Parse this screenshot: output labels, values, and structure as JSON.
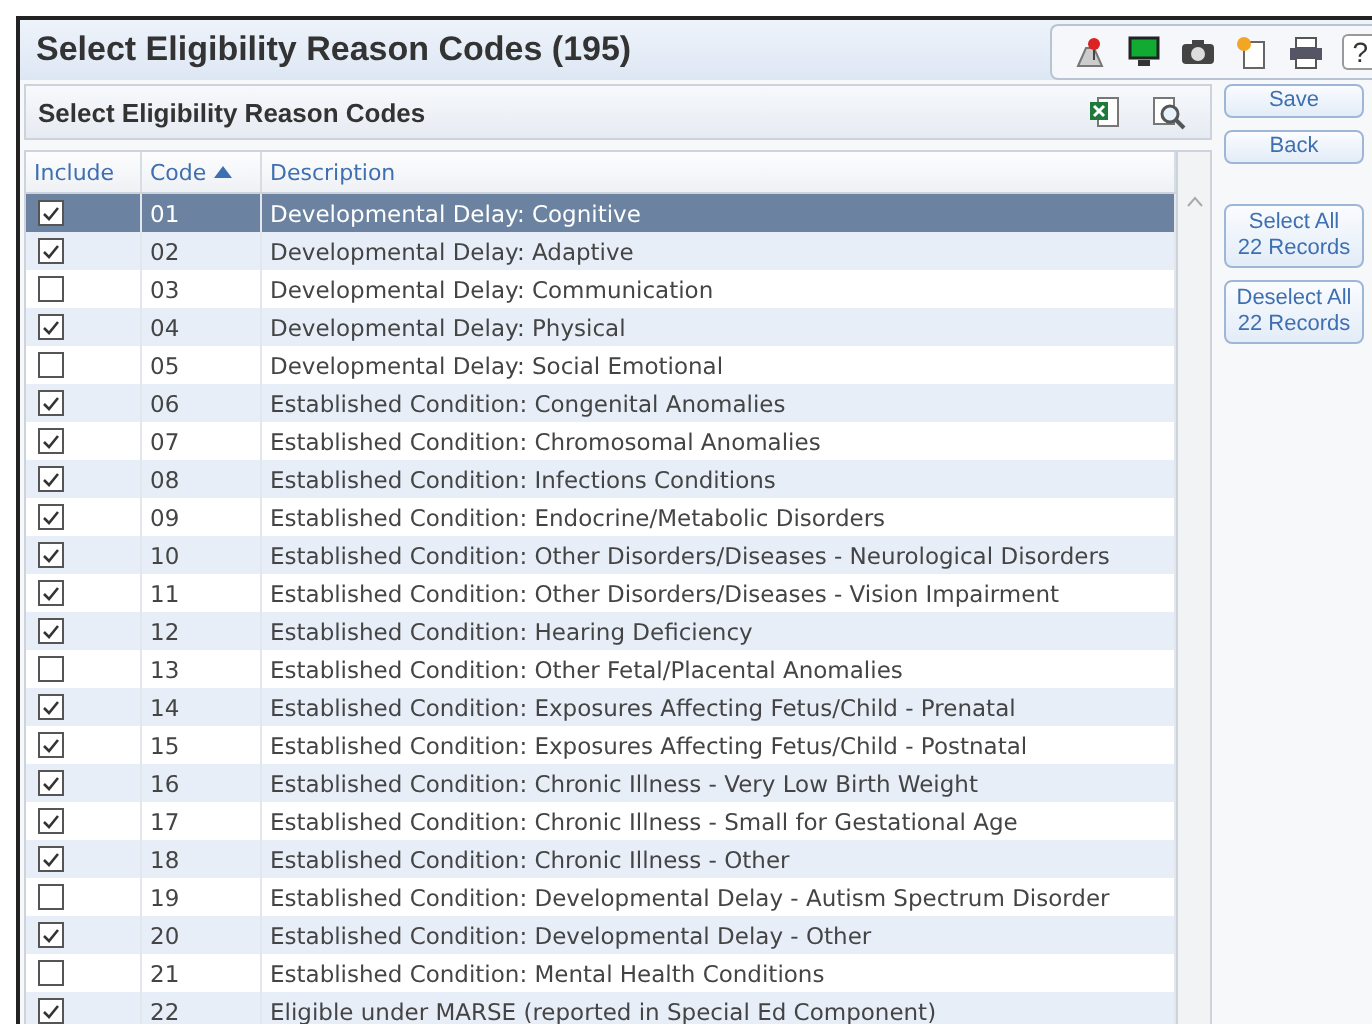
{
  "page": {
    "title": "Select Eligibility Reason Codes (195)",
    "help": "?"
  },
  "panel": {
    "title": "Select Eligibility Reason Codes"
  },
  "table": {
    "columns": [
      {
        "label": "Include",
        "sorted": false
      },
      {
        "label": "Code",
        "sorted": true
      },
      {
        "label": "Description",
        "sorted": false
      }
    ],
    "rows": [
      {
        "include": true,
        "code": "01",
        "description": "Developmental Delay: Cognitive",
        "selected": true
      },
      {
        "include": true,
        "code": "02",
        "description": "Developmental Delay: Adaptive",
        "selected": false
      },
      {
        "include": false,
        "code": "03",
        "description": "Developmental Delay: Communication",
        "selected": false
      },
      {
        "include": true,
        "code": "04",
        "description": "Developmental Delay: Physical",
        "selected": false
      },
      {
        "include": false,
        "code": "05",
        "description": "Developmental Delay: Social Emotional",
        "selected": false
      },
      {
        "include": true,
        "code": "06",
        "description": "Established Condition: Congenital Anomalies",
        "selected": false
      },
      {
        "include": true,
        "code": "07",
        "description": "Established Condition: Chromosomal Anomalies",
        "selected": false
      },
      {
        "include": true,
        "code": "08",
        "description": "Established Condition: Infections Conditions",
        "selected": false
      },
      {
        "include": true,
        "code": "09",
        "description": "Established Condition: Endocrine/Metabolic Disorders",
        "selected": false
      },
      {
        "include": true,
        "code": "10",
        "description": "Established Condition: Other Disorders/Diseases - Neurological Disorders",
        "selected": false
      },
      {
        "include": true,
        "code": "11",
        "description": "Established Condition: Other Disorders/Diseases - Vision Impairment",
        "selected": false
      },
      {
        "include": true,
        "code": "12",
        "description": "Established Condition: Hearing Deficiency",
        "selected": false
      },
      {
        "include": false,
        "code": "13",
        "description": "Established Condition: Other Fetal/Placental Anomalies",
        "selected": false
      },
      {
        "include": true,
        "code": "14",
        "description": "Established Condition: Exposures Affecting Fetus/Child - Prenatal",
        "selected": false
      },
      {
        "include": true,
        "code": "15",
        "description": "Established Condition: Exposures Affecting Fetus/Child - Postnatal",
        "selected": false
      },
      {
        "include": true,
        "code": "16",
        "description": "Established Condition: Chronic Illness - Very Low Birth Weight",
        "selected": false
      },
      {
        "include": true,
        "code": "17",
        "description": "Established Condition: Chronic Illness - Small for Gestational Age",
        "selected": false
      },
      {
        "include": true,
        "code": "18",
        "description": "Established Condition: Chronic Illness - Other",
        "selected": false
      },
      {
        "include": false,
        "code": "19",
        "description": "Established Condition: Developmental Delay - Autism Spectrum Disorder",
        "selected": false
      },
      {
        "include": true,
        "code": "20",
        "description": "Established Condition: Developmental Delay - Other",
        "selected": false
      },
      {
        "include": false,
        "code": "21",
        "description": "Established Condition: Mental Health Conditions",
        "selected": false
      },
      {
        "include": true,
        "code": "22",
        "description": "Eligible under MARSE (reported in Special Ed Component)",
        "selected": false
      }
    ]
  },
  "buttons": [
    {
      "kind": "single",
      "lines": [
        "Save"
      ]
    },
    {
      "kind": "single",
      "lines": [
        "Back"
      ]
    },
    {
      "kind": "double",
      "lines": [
        "Select All",
        "22 Records"
      ]
    },
    {
      "kind": "double",
      "lines": [
        "Deselect All",
        "22 Records"
      ]
    }
  ]
}
